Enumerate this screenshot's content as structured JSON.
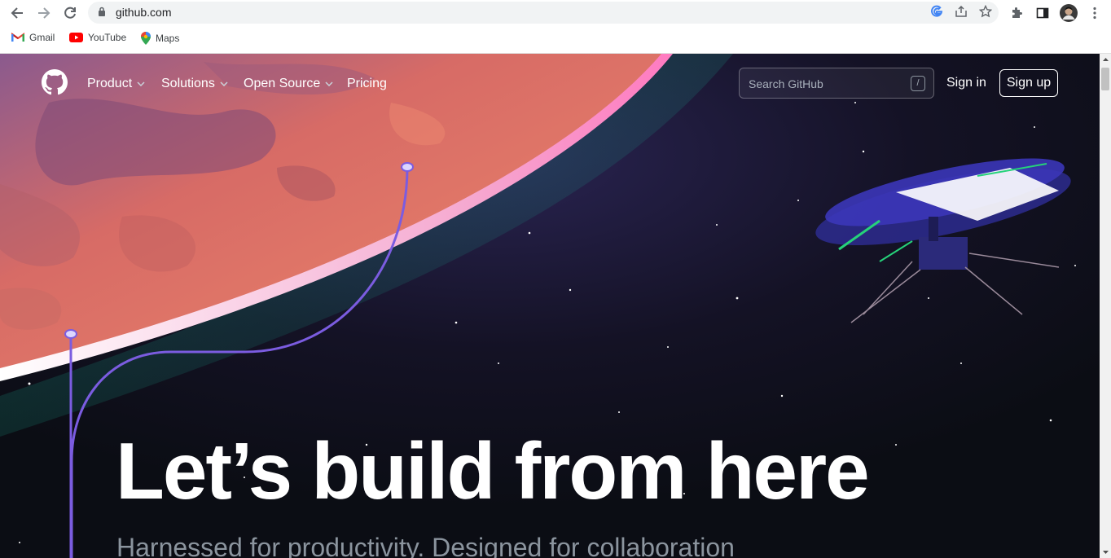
{
  "browser": {
    "url": "github.com",
    "bookmarks": [
      {
        "label": "Gmail",
        "icon": "gmail-icon"
      },
      {
        "label": "YouTube",
        "icon": "youtube-icon"
      },
      {
        "label": "Maps",
        "icon": "maps-icon"
      }
    ]
  },
  "site": {
    "nav": {
      "items": [
        {
          "label": "Product",
          "dropdown": true
        },
        {
          "label": "Solutions",
          "dropdown": true
        },
        {
          "label": "Open Source",
          "dropdown": true
        },
        {
          "label": "Pricing",
          "dropdown": false
        }
      ],
      "search_placeholder": "Search GitHub",
      "search_shortcut": "/",
      "signin_label": "Sign in",
      "signup_label": "Sign up"
    },
    "hero": {
      "headline": "Let’s build from here",
      "subline": "Harnessed for productivity. Designed for collaboration"
    }
  },
  "colors": {
    "page_bg": "#0d1117",
    "planet": "#e8735f",
    "line": "#7b5ce0"
  }
}
